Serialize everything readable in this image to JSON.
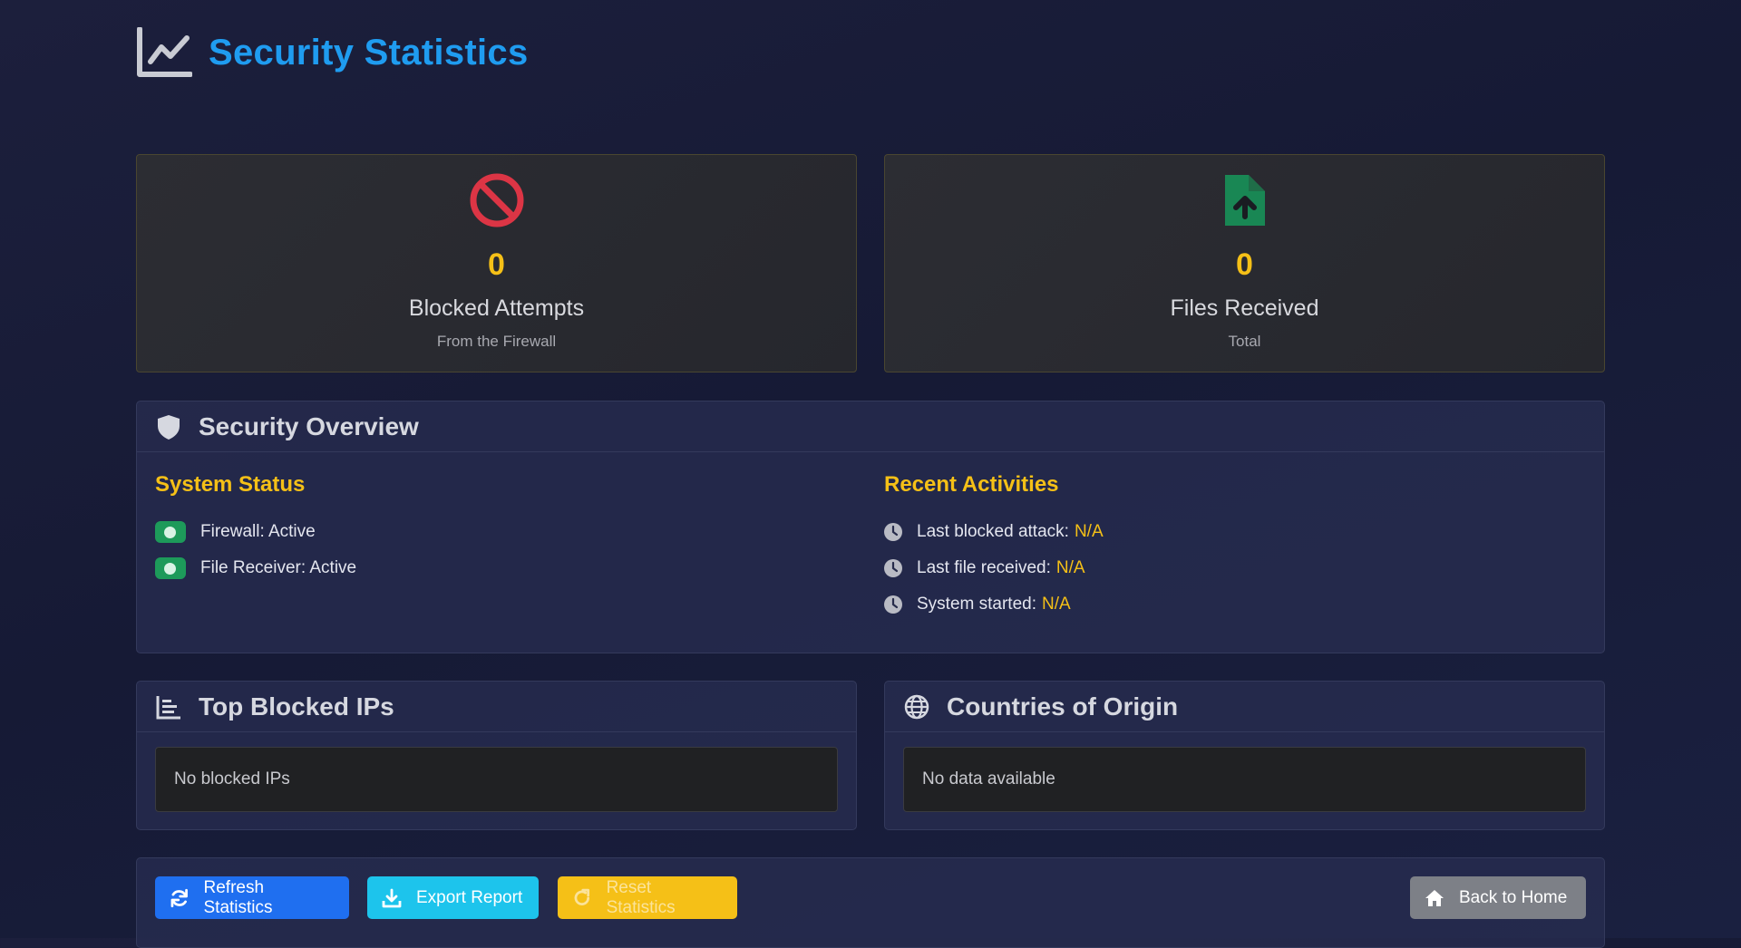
{
  "header": {
    "title": "Security Statistics",
    "icon": "chart-line-icon"
  },
  "stats": [
    {
      "icon": "ban-icon",
      "value": "0",
      "label": "Blocked Attempts",
      "sub": "From the Firewall",
      "color": "#dc3545"
    },
    {
      "icon": "file-upload-icon",
      "value": "0",
      "label": "Files Received",
      "sub": "Total",
      "color": "#198754"
    }
  ],
  "overview": {
    "title": "Security Overview",
    "system_status": {
      "heading": "System Status",
      "items": [
        {
          "label": "Firewall: Active"
        },
        {
          "label": "File Receiver: Active"
        }
      ]
    },
    "recent": {
      "heading": "Recent Activities",
      "items": [
        {
          "label": "Last blocked attack:",
          "value": "N/A"
        },
        {
          "label": "Last file received:",
          "value": "N/A"
        },
        {
          "label": "System started:",
          "value": "N/A"
        }
      ]
    }
  },
  "top_ips": {
    "title": "Top Blocked IPs",
    "empty": "No blocked IPs"
  },
  "countries": {
    "title": "Countries of Origin",
    "empty": "No data available"
  },
  "buttons": {
    "refresh": "Refresh Statistics",
    "export": "Export Report",
    "reset": "Reset Statistics",
    "home": "Back to Home"
  },
  "colors": {
    "accent": "#1f9cf0",
    "warning": "#f5c017",
    "success": "#1d9a5a",
    "danger": "#dc3545"
  }
}
